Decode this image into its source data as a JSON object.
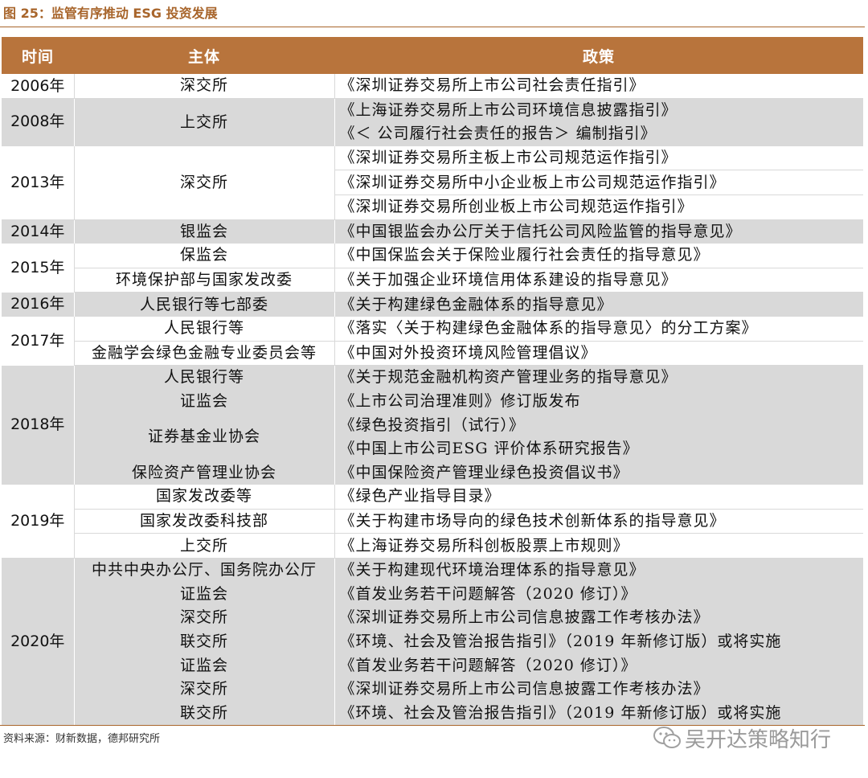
{
  "figure": {
    "title": "图 25：监管有序推动 ESG 投资发展"
  },
  "table": {
    "headers": [
      "时间",
      "主体",
      "政策"
    ],
    "groups": [
      {
        "year": "2006年",
        "shade": "white",
        "rows": [
          {
            "entity": "深交所",
            "policy": "《深圳证券交易所上市公司社会责任指引》"
          }
        ]
      },
      {
        "year": "2008年",
        "shade": "gray",
        "rows": [
          {
            "entity": "上交所",
            "policy": "《上海证券交易所上市公司环境信息披露指引》"
          },
          {
            "entity": "",
            "policy": "《＜ 公司履行社会责任的报告＞ 编制指引》"
          }
        ]
      },
      {
        "year": "2013年",
        "shade": "white",
        "rows": [
          {
            "entity": "深交所",
            "policy": "《深圳证券交易所主板上市公司规范运作指引》"
          },
          {
            "entity": "",
            "policy": "《深圳证券交易所中小企业板上市公司规范运作指引》"
          },
          {
            "entity": "",
            "policy": "《深圳证券交易所创业板上市公司规范运作指引》"
          }
        ]
      },
      {
        "year": "2014年",
        "shade": "gray",
        "rows": [
          {
            "entity": "银监会",
            "policy": "《中国银监会办公厅关于信托公司风险监管的指导意见》"
          }
        ]
      },
      {
        "year": "2015年",
        "shade": "white",
        "rows": [
          {
            "entity": "保监会",
            "policy": "《中国保监会关于保险业履行社会责任的指导意见》"
          },
          {
            "entity": "环境保护部与国家发改委",
            "policy": "《关于加强企业环境信用体系建设的指导意见》"
          }
        ]
      },
      {
        "year": "2016年",
        "shade": "gray",
        "rows": [
          {
            "entity": "人民银行等七部委",
            "policy": "《关于构建绿色金融体系的指导意见》"
          }
        ]
      },
      {
        "year": "2017年",
        "shade": "white",
        "rows": [
          {
            "entity": "人民银行等",
            "policy": "《落实〈关于构建绿色金融体系的指导意见〉的分工方案》"
          },
          {
            "entity": "金融学会绿色金融专业委员会等",
            "policy": "《中国对外投资环境风险管理倡议》"
          }
        ]
      },
      {
        "year": "2018年",
        "shade": "gray",
        "rows": [
          {
            "entity": "人民银行等",
            "policy": "《关于规范金融机构资产管理业务的指导意见》"
          },
          {
            "entity": "证监会",
            "policy": "《上市公司治理准则》修订版发布"
          },
          {
            "entity": "证券基金业协会",
            "policy": "《绿色投资指引（试行）》"
          },
          {
            "entity": "",
            "policy": "《中国上市公司ESG 评价体系研究报告》"
          },
          {
            "entity": "保险资产管理业协会",
            "policy": "《中国保险资产管理业绿色投资倡议书》"
          }
        ]
      },
      {
        "year": "2019年",
        "shade": "white",
        "rows": [
          {
            "entity": "国家发改委等",
            "policy": "《绿色产业指导目录》"
          },
          {
            "entity": "国家发改委科技部",
            "policy": "《关于构建市场导向的绿色技术创新体系的指导意见》"
          },
          {
            "entity": "上交所",
            "policy": "《上海证券交易所科创板股票上市规则》"
          }
        ]
      },
      {
        "year": "2020年",
        "shade": "gray",
        "rows": [
          {
            "entity": "中共中央办公厅、国务院办公厅",
            "policy": "《关于构建现代环境治理体系的指导意见》"
          },
          {
            "entity": "证监会",
            "policy": "《首发业务若干问题解答（2020 修订）》"
          },
          {
            "entity": "深交所",
            "policy": "《深圳证券交易所上市公司信息披露工作考核办法》"
          },
          {
            "entity": "联交所",
            "policy": "《环境、社会及管治报告指引》（2019 年新修订版）或将实施"
          },
          {
            "entity": "证监会",
            "policy": "《首发业务若干问题解答（2020 修订）》"
          },
          {
            "entity": "深交所",
            "policy": "《深圳证券交易所上市公司信息披露工作考核办法》"
          },
          {
            "entity": "联交所",
            "policy": "《环境、社会及管治报告指引》（2019 年新修订版）或将实施"
          }
        ]
      }
    ]
  },
  "footer": {
    "source": "资料来源：财新数据，德邦研究所",
    "watermark": "吴开达策略知行",
    "watermark_icon": "wechat-icon"
  }
}
